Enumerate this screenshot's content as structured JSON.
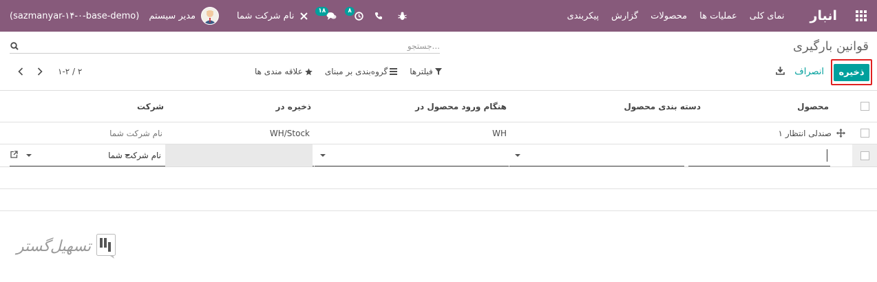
{
  "navbar": {
    "brand": "انبار",
    "menu": [
      "نمای کلی",
      "عملیات ها",
      "محصولات",
      "گزارش",
      "پیکربندی"
    ],
    "user_name": "مدیر سیستم",
    "database": "(sazmanyar-۱۴-۰-base-demo)",
    "company": "نام شرکت شما",
    "messages_badge": "۱۸",
    "activities_badge": "۸"
  },
  "control_panel": {
    "title": "قوانین بارگیری",
    "search_placeholder": "جستجو...",
    "save_label": "ذخیره",
    "discard_label": "انصراف",
    "filters_label": "فیلترها",
    "groupby_label": "گروه‌بندی بر مبنای",
    "favorites_label": "علاقه مندی ها",
    "pager_value": "۱-۲ / ۲"
  },
  "table": {
    "columns": [
      "محصول",
      "دسته بندی محصول",
      "هنگام ورود محصول در",
      "ذخیره در",
      "شرکت"
    ],
    "rows": [
      {
        "product": "صندلی انتظار ۱",
        "category": "",
        "when_in": "WH",
        "store_to": "WH/Stock",
        "company": "نام شرکت شما"
      }
    ],
    "edit_row": {
      "company": "نام شرکت شما"
    }
  },
  "watermark": {
    "text": "تسهیل‌گستر"
  },
  "colors": {
    "navbar": "#875a7b",
    "primary": "#00a09d",
    "highlight": "#e02020"
  }
}
